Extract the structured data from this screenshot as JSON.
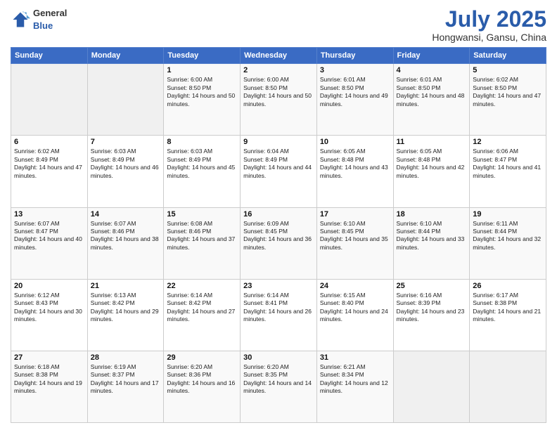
{
  "logo": {
    "general": "General",
    "blue": "Blue"
  },
  "header": {
    "title": "July 2025",
    "subtitle": "Hongwansi, Gansu, China"
  },
  "weekdays": [
    "Sunday",
    "Monday",
    "Tuesday",
    "Wednesday",
    "Thursday",
    "Friday",
    "Saturday"
  ],
  "weeks": [
    [
      {
        "day": "",
        "info": ""
      },
      {
        "day": "",
        "info": ""
      },
      {
        "day": "1",
        "info": "Sunrise: 6:00 AM\nSunset: 8:50 PM\nDaylight: 14 hours and 50 minutes."
      },
      {
        "day": "2",
        "info": "Sunrise: 6:00 AM\nSunset: 8:50 PM\nDaylight: 14 hours and 50 minutes."
      },
      {
        "day": "3",
        "info": "Sunrise: 6:01 AM\nSunset: 8:50 PM\nDaylight: 14 hours and 49 minutes."
      },
      {
        "day": "4",
        "info": "Sunrise: 6:01 AM\nSunset: 8:50 PM\nDaylight: 14 hours and 48 minutes."
      },
      {
        "day": "5",
        "info": "Sunrise: 6:02 AM\nSunset: 8:50 PM\nDaylight: 14 hours and 47 minutes."
      }
    ],
    [
      {
        "day": "6",
        "info": "Sunrise: 6:02 AM\nSunset: 8:49 PM\nDaylight: 14 hours and 47 minutes."
      },
      {
        "day": "7",
        "info": "Sunrise: 6:03 AM\nSunset: 8:49 PM\nDaylight: 14 hours and 46 minutes."
      },
      {
        "day": "8",
        "info": "Sunrise: 6:03 AM\nSunset: 8:49 PM\nDaylight: 14 hours and 45 minutes."
      },
      {
        "day": "9",
        "info": "Sunrise: 6:04 AM\nSunset: 8:49 PM\nDaylight: 14 hours and 44 minutes."
      },
      {
        "day": "10",
        "info": "Sunrise: 6:05 AM\nSunset: 8:48 PM\nDaylight: 14 hours and 43 minutes."
      },
      {
        "day": "11",
        "info": "Sunrise: 6:05 AM\nSunset: 8:48 PM\nDaylight: 14 hours and 42 minutes."
      },
      {
        "day": "12",
        "info": "Sunrise: 6:06 AM\nSunset: 8:47 PM\nDaylight: 14 hours and 41 minutes."
      }
    ],
    [
      {
        "day": "13",
        "info": "Sunrise: 6:07 AM\nSunset: 8:47 PM\nDaylight: 14 hours and 40 minutes."
      },
      {
        "day": "14",
        "info": "Sunrise: 6:07 AM\nSunset: 8:46 PM\nDaylight: 14 hours and 38 minutes."
      },
      {
        "day": "15",
        "info": "Sunrise: 6:08 AM\nSunset: 8:46 PM\nDaylight: 14 hours and 37 minutes."
      },
      {
        "day": "16",
        "info": "Sunrise: 6:09 AM\nSunset: 8:45 PM\nDaylight: 14 hours and 36 minutes."
      },
      {
        "day": "17",
        "info": "Sunrise: 6:10 AM\nSunset: 8:45 PM\nDaylight: 14 hours and 35 minutes."
      },
      {
        "day": "18",
        "info": "Sunrise: 6:10 AM\nSunset: 8:44 PM\nDaylight: 14 hours and 33 minutes."
      },
      {
        "day": "19",
        "info": "Sunrise: 6:11 AM\nSunset: 8:44 PM\nDaylight: 14 hours and 32 minutes."
      }
    ],
    [
      {
        "day": "20",
        "info": "Sunrise: 6:12 AM\nSunset: 8:43 PM\nDaylight: 14 hours and 30 minutes."
      },
      {
        "day": "21",
        "info": "Sunrise: 6:13 AM\nSunset: 8:42 PM\nDaylight: 14 hours and 29 minutes."
      },
      {
        "day": "22",
        "info": "Sunrise: 6:14 AM\nSunset: 8:42 PM\nDaylight: 14 hours and 27 minutes."
      },
      {
        "day": "23",
        "info": "Sunrise: 6:14 AM\nSunset: 8:41 PM\nDaylight: 14 hours and 26 minutes."
      },
      {
        "day": "24",
        "info": "Sunrise: 6:15 AM\nSunset: 8:40 PM\nDaylight: 14 hours and 24 minutes."
      },
      {
        "day": "25",
        "info": "Sunrise: 6:16 AM\nSunset: 8:39 PM\nDaylight: 14 hours and 23 minutes."
      },
      {
        "day": "26",
        "info": "Sunrise: 6:17 AM\nSunset: 8:38 PM\nDaylight: 14 hours and 21 minutes."
      }
    ],
    [
      {
        "day": "27",
        "info": "Sunrise: 6:18 AM\nSunset: 8:38 PM\nDaylight: 14 hours and 19 minutes."
      },
      {
        "day": "28",
        "info": "Sunrise: 6:19 AM\nSunset: 8:37 PM\nDaylight: 14 hours and 17 minutes."
      },
      {
        "day": "29",
        "info": "Sunrise: 6:20 AM\nSunset: 8:36 PM\nDaylight: 14 hours and 16 minutes."
      },
      {
        "day": "30",
        "info": "Sunrise: 6:20 AM\nSunset: 8:35 PM\nDaylight: 14 hours and 14 minutes."
      },
      {
        "day": "31",
        "info": "Sunrise: 6:21 AM\nSunset: 8:34 PM\nDaylight: 14 hours and 12 minutes."
      },
      {
        "day": "",
        "info": ""
      },
      {
        "day": "",
        "info": ""
      }
    ]
  ]
}
